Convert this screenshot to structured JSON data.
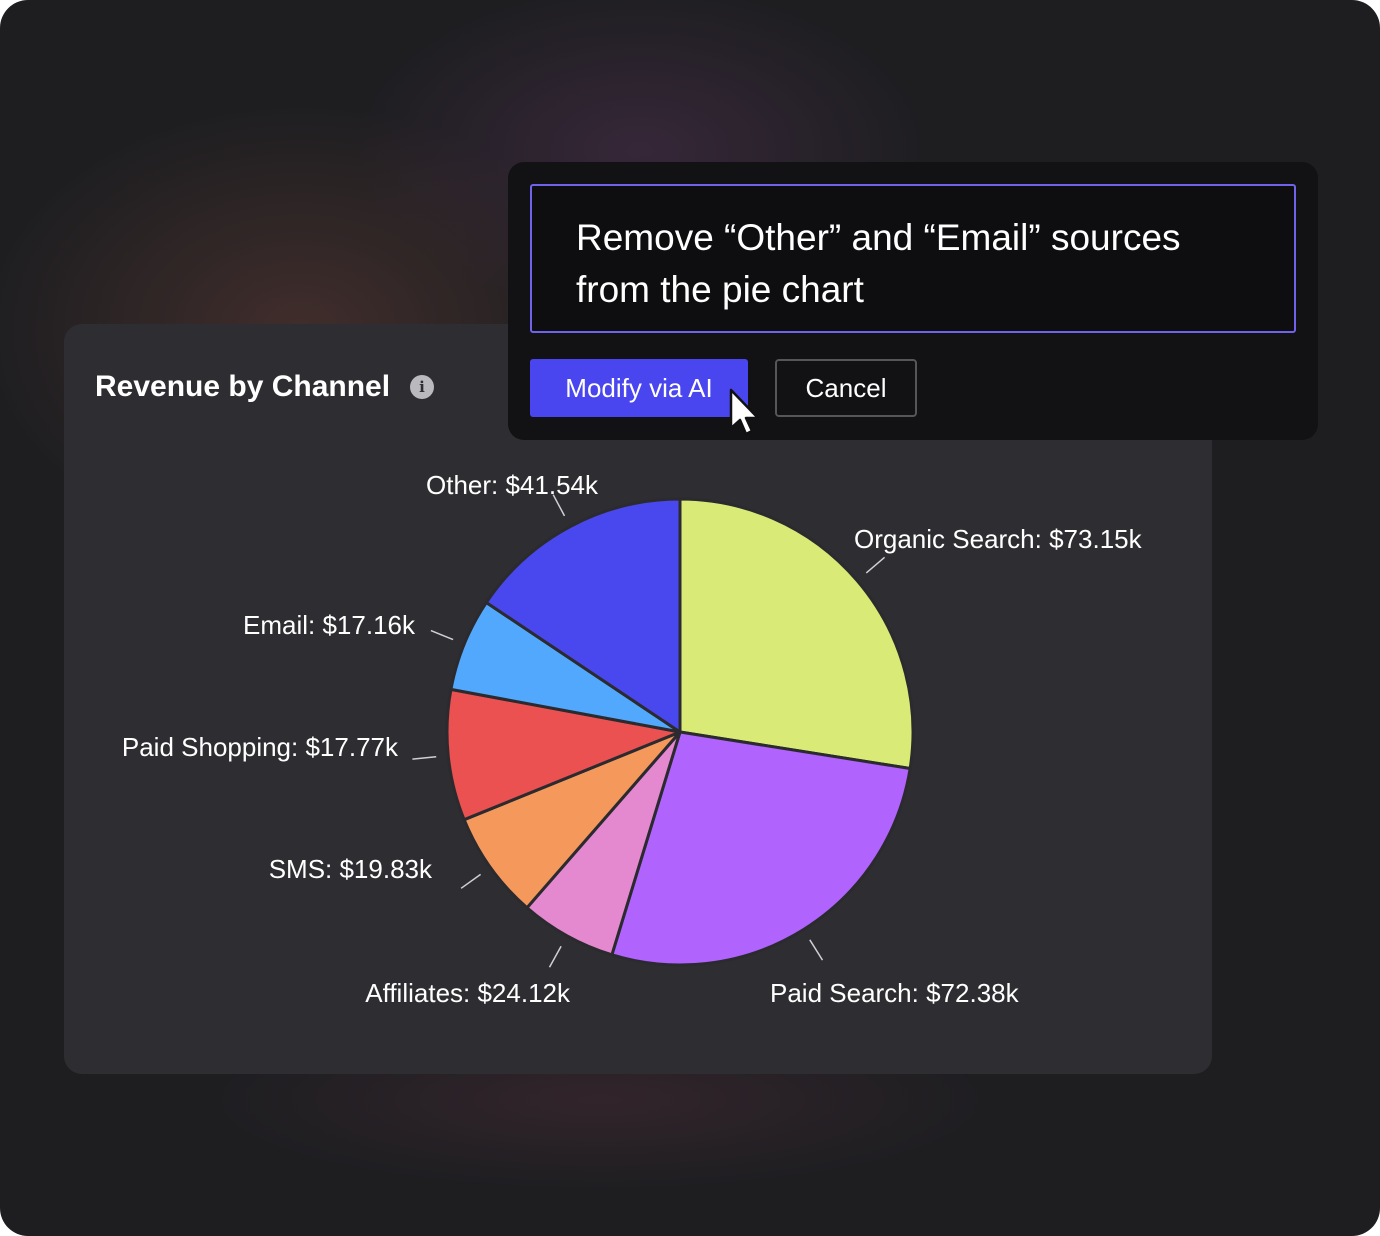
{
  "card": {
    "title": "Revenue by Channel",
    "info_icon": "info-icon"
  },
  "prompt_dialog": {
    "prompt_text": "Remove “Other” and “Email” sources from the pie chart",
    "modify_label": "Modify via AI",
    "cancel_label": "Cancel",
    "cursor_icon": "pointer-cursor-icon"
  },
  "colors": {
    "accent": "#4945ef",
    "background": "#1e1e21",
    "card": "#2e2e32",
    "prompt_border": "#6e63ea"
  },
  "chart_data": {
    "type": "pie",
    "unit_prefix": "$",
    "unit_suffix": "k",
    "slices": [
      {
        "name": "Organic Search",
        "value": 73.15,
        "color": "#d9eb76"
      },
      {
        "name": "Paid Search",
        "value": 72.38,
        "color": "#b063fd"
      },
      {
        "name": "Paid Shopping",
        "value": 17.77,
        "color": "#e488d0"
      },
      {
        "name": "SMS",
        "value": 19.83,
        "color": "#f5985c"
      },
      {
        "name": "Affiliates",
        "value": 24.12,
        "color": "#ea5150"
      },
      {
        "name": "Email",
        "value": 17.16,
        "color": "#52a8fc"
      },
      {
        "name": "Other",
        "value": 41.54,
        "color": "#4948ef"
      }
    ],
    "labels": [
      {
        "slice": "Organic Search",
        "text": "Organic Search: $73.15k"
      },
      {
        "slice": "Paid Search",
        "text": "Paid Search: $72.38k"
      },
      {
        "slice": "Affiliates",
        "text": "Affiliates: $24.12k"
      },
      {
        "slice": "SMS",
        "text": "SMS: $19.83k"
      },
      {
        "slice": "Paid Shopping",
        "text": "Paid Shopping: $17.77k"
      },
      {
        "slice": "Email",
        "text": "Email: $17.16k"
      },
      {
        "slice": "Other",
        "text": "Other: $41.54k"
      }
    ]
  }
}
